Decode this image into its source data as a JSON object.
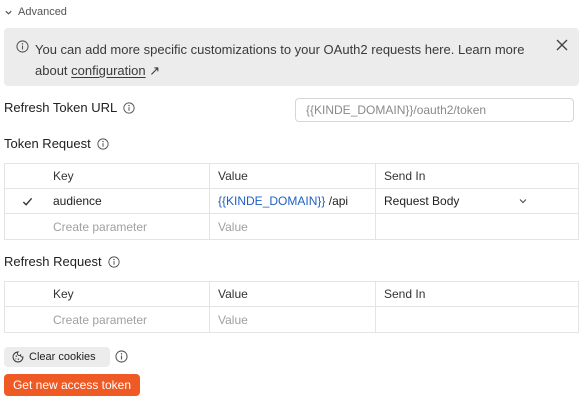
{
  "advanced": {
    "label": "Advanced"
  },
  "banner": {
    "text": "You can add more specific customizations to your OAuth2 requests here. Learn more about",
    "link_text": "configuration",
    "link_arrow": "↗"
  },
  "refresh_token_url": {
    "label": "Refresh Token URL",
    "placeholder": "{{KINDE_DOMAIN}}/oauth2/token"
  },
  "token_request": {
    "label": "Token Request",
    "columns": [
      "Key",
      "Value",
      "Send In"
    ],
    "rows": [
      {
        "key": "audience",
        "value_var": "{{KINDE_DOMAIN}}",
        "value_rest": "/api",
        "send_in": "Request Body",
        "checked": true
      }
    ],
    "new_row": {
      "key_placeholder": "Create parameter",
      "value_placeholder": "Value"
    }
  },
  "refresh_request": {
    "label": "Refresh Request",
    "columns": [
      "Key",
      "Value",
      "Send In"
    ],
    "new_row": {
      "key_placeholder": "Create parameter",
      "value_placeholder": "Value"
    }
  },
  "buttons": {
    "clear_cookies": "Clear cookies",
    "get_token": "Get new access token"
  },
  "colors": {
    "accent": "#ef5a24",
    "variable": "#1f5fc4",
    "banner_bg": "#ececec"
  }
}
